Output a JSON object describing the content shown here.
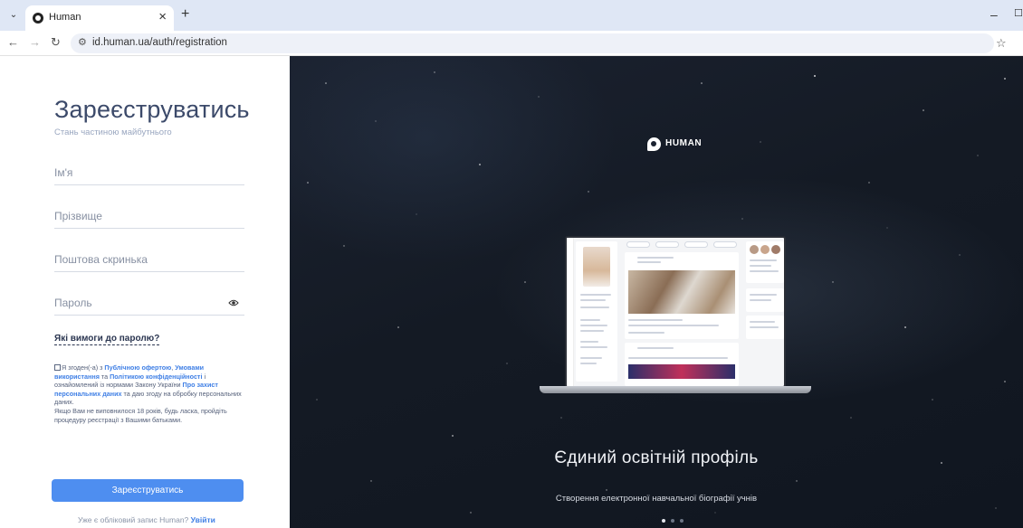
{
  "browser": {
    "tab_title": "Human",
    "url": "id.human.ua/auth/registration"
  },
  "form": {
    "title": "Зареєструватись",
    "subtitle": "Стань частиною майбутнього",
    "first_name_placeholder": "Ім'я",
    "last_name_placeholder": "Прізвище",
    "email_placeholder": "Поштова скринька",
    "password_placeholder": "Пароль",
    "password_requirements": "Які вимоги до паролю?",
    "consent": {
      "part1": "Я згоден(-а) з ",
      "link_offer": "Публічною офертою",
      "sep1": ", ",
      "link_terms": "Умовами використання",
      "part2": " та ",
      "link_privacy": "Політикою конфіденційності",
      "part3": " і ознайомлений із нормами Закону України ",
      "link_law": "Про захист персональних даних",
      "part4": " та даю згоду на обробку персональних даних.",
      "minor_note": "Якщо Вам не виповнилося 18 років, будь ласка, пройдіть процедуру реєстрації з Вашими батьками."
    },
    "submit_label": "Зареєструватись",
    "login_prompt": "Уже є обліковий запис Human?",
    "login_link": "Увійти"
  },
  "hero": {
    "logo_text": "HUMAN",
    "title": "Єдиний освітній профіль",
    "subtitle": "Створення електронної навчальної біографії учнів",
    "slides_total": 3,
    "slide_active": 1
  }
}
